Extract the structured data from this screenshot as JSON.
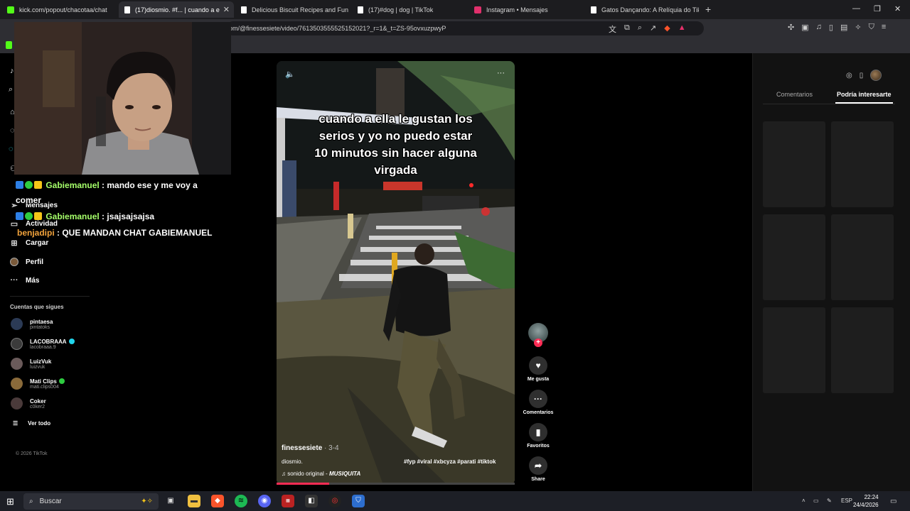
{
  "browser": {
    "tabs": [
      {
        "label": "kick.com/popout/chacotaa/chat",
        "favicon_color": "#53fc18"
      },
      {
        "label": "(17)diosmio. #f... | cuando a e",
        "favicon_color": "#ffffff"
      },
      {
        "label": "Delicious Biscuit Recipes and Fun Fac",
        "favicon_color": "#ffffff"
      },
      {
        "label": "(17)#dog | dog | TikTok",
        "favicon_color": "#ffffff"
      },
      {
        "label": "Instagram • Mensajes",
        "favicon_color": "#e1306c"
      },
      {
        "label": "Gatos Dançando: A Relíquia do TikTo",
        "favicon_color": "#ffffff"
      }
    ],
    "new_tab": "+",
    "url": "om/@finessesiete/video/7613503555525152021?_r=1&_t=ZS-95ovxuzpwyP"
  },
  "sidebar": {
    "items": [
      {
        "label": "Mensajes",
        "icon": "send-icon"
      },
      {
        "label": "Actividad",
        "icon": "inbox-icon"
      },
      {
        "label": "Cargar",
        "icon": "plus-box-icon"
      },
      {
        "label": "Perfil",
        "icon": "avatar-icon"
      },
      {
        "label": "Más",
        "icon": "more-icon"
      }
    ],
    "following_title": "Cuentas que sigues",
    "following": [
      {
        "name": "pintaesa",
        "user": "pintatoks",
        "verified": false,
        "color": "#2b3a55"
      },
      {
        "name": "LACOBRAAA",
        "user": "lacobraaa.9",
        "verified": true,
        "badge_color": "#20d5ec",
        "color": "#3b3b3b"
      },
      {
        "name": "LuizVuk",
        "user": "luizvuk",
        "verified": false,
        "color": "#6a5a5a"
      },
      {
        "name": "Mati Clips",
        "user": "mati.clips004",
        "verified": true,
        "badge_color": "#2ecc40",
        "color": "#8a6a3a"
      },
      {
        "name": "Coker",
        "user": "c0ker2",
        "verified": false,
        "color": "#4a3a3a"
      }
    ],
    "see_all": "Ver todo",
    "copyright": "© 2026 TikTok"
  },
  "chat": [
    {
      "user": "Gabiemanuel",
      "message": ": mando ese y me voy a",
      "continuation": "comer"
    },
    {
      "user": "Gabiemanuel",
      "message": ": jsajsajsajsa"
    },
    {
      "user": "benjadipi",
      "message": ": QUE MANDAN CHAT GABIEMANUEL"
    }
  ],
  "video": {
    "caption_lines": [
      "cuando a ella le gustan los",
      "serios y yo no puedo estar",
      "10 minutos sin hacer alguna",
      "virgada"
    ],
    "author": "finessesiete",
    "date": " · 3-4",
    "description": "diosmio.",
    "tags": "#fyp #viral #xbcyza #parati #tiktok",
    "sound": "sonido original - ",
    "sound_artist": "MUSIQUITA",
    "progress": 0.22
  },
  "actions": {
    "like": "Me gusta",
    "comments": "Comentarios",
    "favorites": "Favoritos",
    "share": "Share"
  },
  "right_panel": {
    "tabs": [
      "Comentarios",
      "Podría interesarte"
    ]
  },
  "taskbar": {
    "search_label": "Buscar",
    "lang": "ESP",
    "time": "22:24",
    "date": "24/4/2026"
  }
}
